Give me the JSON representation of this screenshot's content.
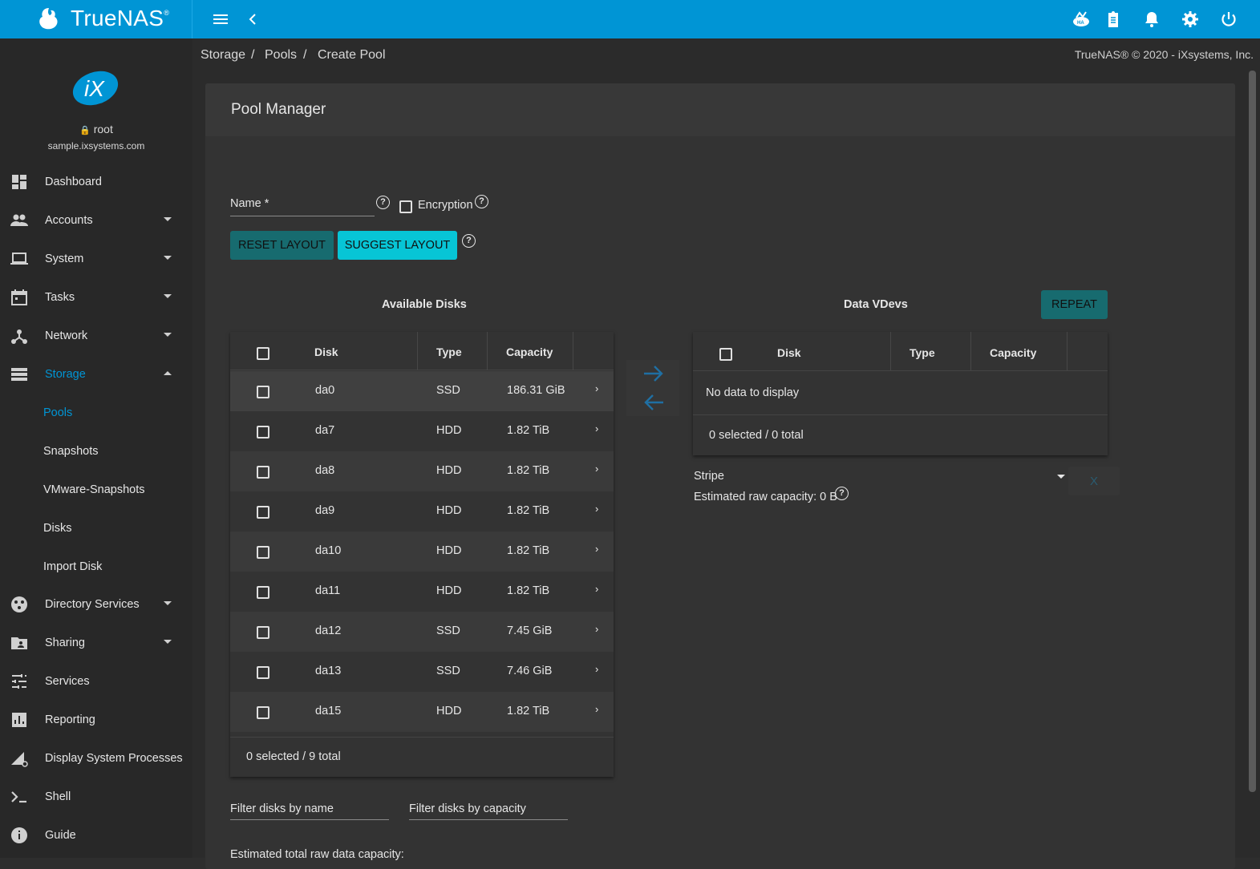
{
  "topbar": {
    "brand": "TrueNAS",
    "brand_mark": "®",
    "icons": [
      "truecommand-icon",
      "tasks-clipboard-icon",
      "notifications-bell-icon",
      "settings-gear-icon",
      "power-icon"
    ]
  },
  "sidebar": {
    "user": "root",
    "hostname": "sample.ixsystems.com",
    "items": [
      {
        "label": "Dashboard"
      },
      {
        "label": "Accounts"
      },
      {
        "label": "System"
      },
      {
        "label": "Tasks"
      },
      {
        "label": "Network"
      },
      {
        "label": "Storage"
      },
      {
        "label": "Directory Services"
      },
      {
        "label": "Sharing"
      },
      {
        "label": "Services"
      },
      {
        "label": "Reporting"
      },
      {
        "label": "Display System Processes"
      },
      {
        "label": "Shell"
      },
      {
        "label": "Guide"
      }
    ],
    "storage_sub": [
      "Pools",
      "Snapshots",
      "VMware-Snapshots",
      "Disks",
      "Import Disk"
    ]
  },
  "breadcrumb": {
    "items": [
      "Storage",
      "Pools",
      "Create Pool"
    ],
    "separator": "/"
  },
  "copyright": "TrueNAS® © 2020 - iXsystems, Inc.",
  "pool_manager": {
    "title": "Pool Manager",
    "name_label": "Name *",
    "encryption_label": "Encryption",
    "reset_layout": "RESET LAYOUT",
    "suggest_layout": "SUGGEST LAYOUT",
    "available_disks_title": "Available Disks",
    "data_vdevs_title": "Data VDevs",
    "repeat": "REPEAT",
    "columns": {
      "disk": "Disk",
      "type": "Type",
      "capacity": "Capacity"
    },
    "disks": [
      {
        "name": "da0",
        "type": "SSD",
        "capacity": "186.31 GiB"
      },
      {
        "name": "da7",
        "type": "HDD",
        "capacity": "1.82 TiB"
      },
      {
        "name": "da8",
        "type": "HDD",
        "capacity": "1.82 TiB"
      },
      {
        "name": "da9",
        "type": "HDD",
        "capacity": "1.82 TiB"
      },
      {
        "name": "da10",
        "type": "HDD",
        "capacity": "1.82 TiB"
      },
      {
        "name": "da11",
        "type": "HDD",
        "capacity": "1.82 TiB"
      },
      {
        "name": "da12",
        "type": "SSD",
        "capacity": "7.45 GiB"
      },
      {
        "name": "da13",
        "type": "SSD",
        "capacity": "7.46 GiB"
      },
      {
        "name": "da15",
        "type": "HDD",
        "capacity": "1.82 TiB"
      }
    ],
    "available_footer": "0 selected / 9 total",
    "vdev_empty": "No data to display",
    "vdev_footer": "0 selected / 0 total",
    "vdev_layout": "Stripe",
    "estimated_raw": "Estimated raw capacity: 0 B",
    "remove_button": "X",
    "filter_name": "Filter disks by name",
    "filter_capacity": "Filter disks by capacity",
    "estimated_total": "Estimated total raw data capacity:"
  }
}
